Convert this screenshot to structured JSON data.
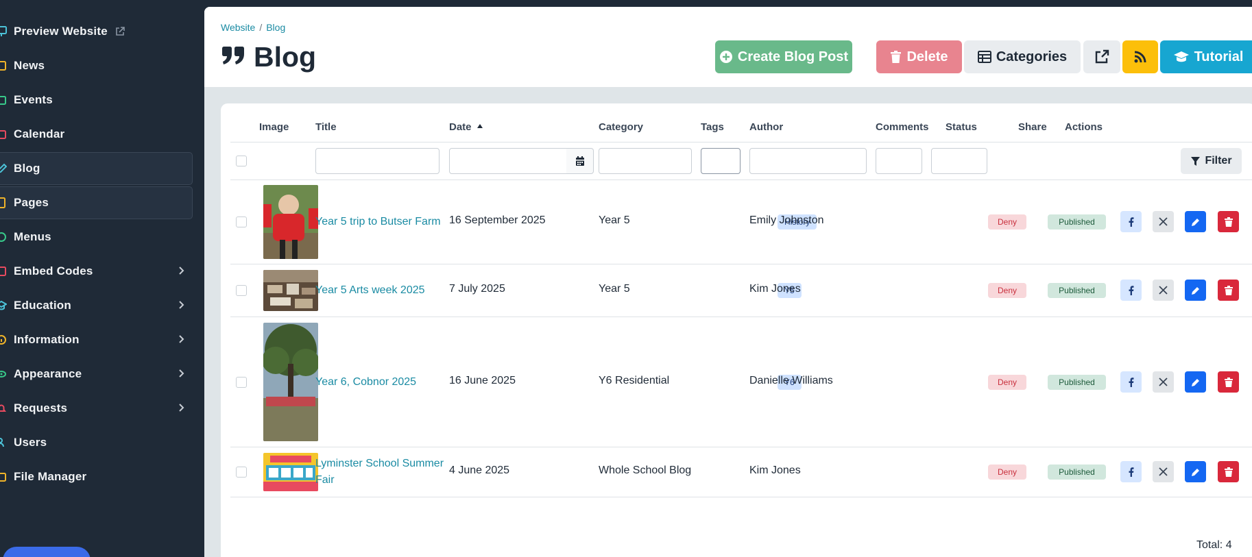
{
  "sidebar": {
    "items": [
      {
        "label": "Preview Website",
        "icon": "monitor-icon"
      },
      {
        "label": "News",
        "icon": "news-icon"
      },
      {
        "label": "Events",
        "icon": "events-icon"
      },
      {
        "label": "Calendar",
        "icon": "calendar-icon"
      },
      {
        "label": "Blog",
        "icon": "pen-icon"
      },
      {
        "label": "Pages",
        "icon": "page-icon"
      },
      {
        "label": "Menus",
        "icon": "menu-icon"
      },
      {
        "label": "Embed Codes",
        "icon": "code-icon"
      },
      {
        "label": "Education",
        "icon": "graduation-icon"
      },
      {
        "label": "Information",
        "icon": "info-icon"
      },
      {
        "label": "Appearance",
        "icon": "eye-icon"
      },
      {
        "label": "Requests",
        "icon": "bell-icon"
      },
      {
        "label": "Users",
        "icon": "users-icon"
      },
      {
        "label": "File Manager",
        "icon": "folder-icon"
      }
    ]
  },
  "breadcrumb": {
    "home": "Website",
    "separator": "/",
    "current": "Blog"
  },
  "page": {
    "title": "Blog"
  },
  "toolbar": {
    "create_label": "Create Blog Post",
    "delete_label": "Delete",
    "categories_label": "Categories",
    "tutorial_label": "Tutorial"
  },
  "table": {
    "headers": {
      "image": "Image",
      "title": "Title",
      "date": "Date",
      "category": "Category",
      "tags": "Tags",
      "author": "Author",
      "comments": "Comments",
      "status": "Status",
      "share": "Share",
      "actions": "Actions"
    },
    "filter_label": "Filter",
    "rows": [
      {
        "title": "Year 5 trip to Butser Farm",
        "date": "16 September 2025",
        "category": "Year 5",
        "tag": "History",
        "author": "Emily Johnston",
        "comments": "Deny",
        "status": "Published"
      },
      {
        "title": "Year 5 Arts week 2025",
        "date": "7 July 2025",
        "category": "Year 5",
        "tag": "Y5",
        "author": "Kim Jones",
        "comments": "Deny",
        "status": "Published"
      },
      {
        "title": "Year 6, Cobnor 2025",
        "date": "16 June 2025",
        "category": "Y6 Residential",
        "tag": "Y6",
        "author": "Danielle Williams",
        "comments": "Deny",
        "status": "Published"
      },
      {
        "title": "Lyminster School Summer Fair",
        "date": "4 June 2025",
        "category": "Whole School Blog",
        "tag": "",
        "author": "Kim Jones",
        "comments": "Deny",
        "status": "Published"
      }
    ],
    "total_label": "Total: 4"
  },
  "colors": {
    "sidebar_bg": "#1f2a37",
    "link": "#1a8ba3",
    "create": "#69b98a",
    "delete": "#e8848f",
    "rss": "#fcbf0a",
    "tutorial": "#17a6d1",
    "edit": "#1467f2",
    "danger": "#d9283b"
  }
}
